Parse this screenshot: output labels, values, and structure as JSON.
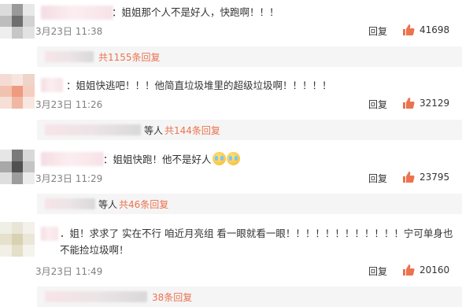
{
  "comments": [
    {
      "text": "：姐姐那个人不是好人，快跑啊！！！",
      "time": "3月23日 11:38",
      "reply_label": "回复",
      "likes": "41698",
      "sub_who": "",
      "sub_more": "共1155条回复"
    },
    {
      "text": "：姐姐快逃吧！！！他简直垃圾堆里的超级垃圾啊！！！！！",
      "time": "3月23日 11:26",
      "reply_label": "回复",
      "likes": "32129",
      "sub_who": "等人",
      "sub_more": "共144条回复"
    },
    {
      "text": "：姐姐快跑！他不是好人",
      "time": "3月23日 11:29",
      "reply_label": "回复",
      "likes": "23795",
      "sub_who": "等人",
      "sub_more": "共46条回复"
    },
    {
      "text": "．姐！求求了 实在不行 咱近月亮组 看一眼就看一眼！！！！！！！！！！！！宁可单身也不能捡垃圾啊！",
      "time": "3月23日 11:49",
      "reply_label": "回复",
      "likes": "20160",
      "sub_who": "",
      "sub_more": "38条回复"
    }
  ],
  "colors": {
    "like_icon": "#eb7350",
    "more_link": "#eb7350",
    "sub_bg": "#f5f5f5"
  }
}
